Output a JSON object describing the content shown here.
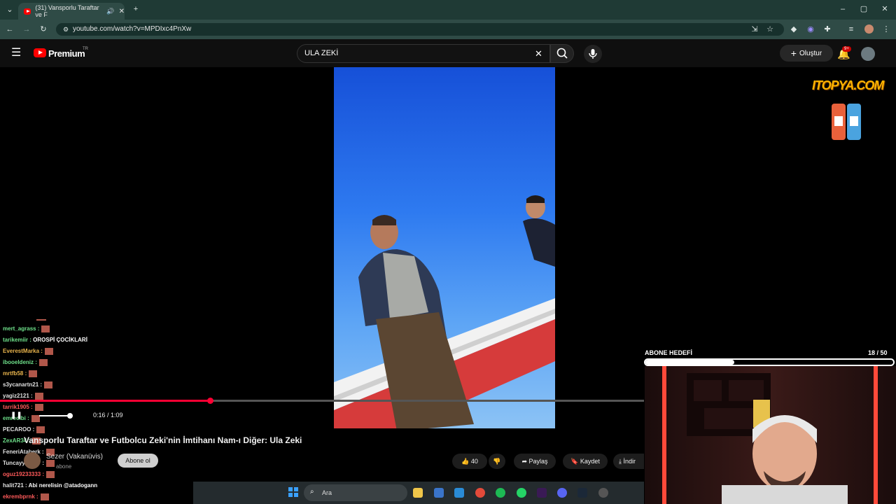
{
  "browser": {
    "tab_title": "(31) Vansporlu Taraftar ve F",
    "url": "youtube.com/watch?v=MPDIxc4PnXw"
  },
  "youtube": {
    "logo_text": "Premium",
    "logo_region": "TR",
    "search_value": "ULA ZEKİ",
    "create_label": "Oluştur",
    "notif_badge": "9+"
  },
  "player": {
    "time_display": "0:16 / 1:09",
    "progress": 0.326
  },
  "video": {
    "title": "Vansporlu Taraftar ve Futbolcu Zeki'nin İmtihanı Nam-ı Diğer: Ula Zeki",
    "channel": "Sezer (Vakanüvis)",
    "subscribers": "abone",
    "subscribe_label": "Abone ol",
    "like_count": "40",
    "share_label": "Paylaş",
    "save_label": "Kaydet",
    "download_label": "İndir"
  },
  "overlay": {
    "sponsor": "ITOPYA.COM",
    "goal_label": "ABONE HEDEFİ",
    "goal_count": "18 / 50",
    "goal_fraction": 0.36
  },
  "chat": [
    {
      "user": "mert_agrass :",
      "msg": "",
      "color": "#6ee08a"
    },
    {
      "user": "tarikemiir :",
      "msg": "OROSPİ ÇOCİKLARİ",
      "color": "#6ee08a"
    },
    {
      "user": "EverestMarka :",
      "msg": "",
      "color": "#e9b44c"
    },
    {
      "user": "ibooeldeniz :",
      "msg": "",
      "color": "#6ee08a"
    },
    {
      "user": "mrtfb58 :",
      "msg": "",
      "color": "#e9b44c"
    },
    {
      "user": "s3ycanartn21 :",
      "msg": "",
      "color": "#e0e0e0"
    },
    {
      "user": "yagiz2121 :",
      "msg": "",
      "color": "#e0e0e0"
    },
    {
      "user": "tarrik1905 :",
      "msg": "",
      "color": "#ff5a5a"
    },
    {
      "user": "emrecibi :",
      "msg": "",
      "color": "#6ee08a"
    },
    {
      "user": "PECAROO :",
      "msg": "",
      "color": "#e0e0e0"
    },
    {
      "user": "ZexAR34 :",
      "msg": "",
      "color": "#6ee08a"
    },
    {
      "user": "FeneriAtaberk :",
      "msg": "",
      "color": "#e0e0e0"
    },
    {
      "user": "Tuncayy_1907 :",
      "msg": "",
      "color": "#e0e0e0"
    },
    {
      "user": "oguz19233333 :",
      "msg": "",
      "color": "#ff5a5a"
    },
    {
      "user": "halit721 :",
      "msg": "Abi nerelisin @atadogann",
      "color": "#e0e0e0"
    },
    {
      "user": "ekrembprnk :",
      "msg": "",
      "color": "#ff5a5a"
    }
  ],
  "taskbar": {
    "search_label": "Ara"
  }
}
